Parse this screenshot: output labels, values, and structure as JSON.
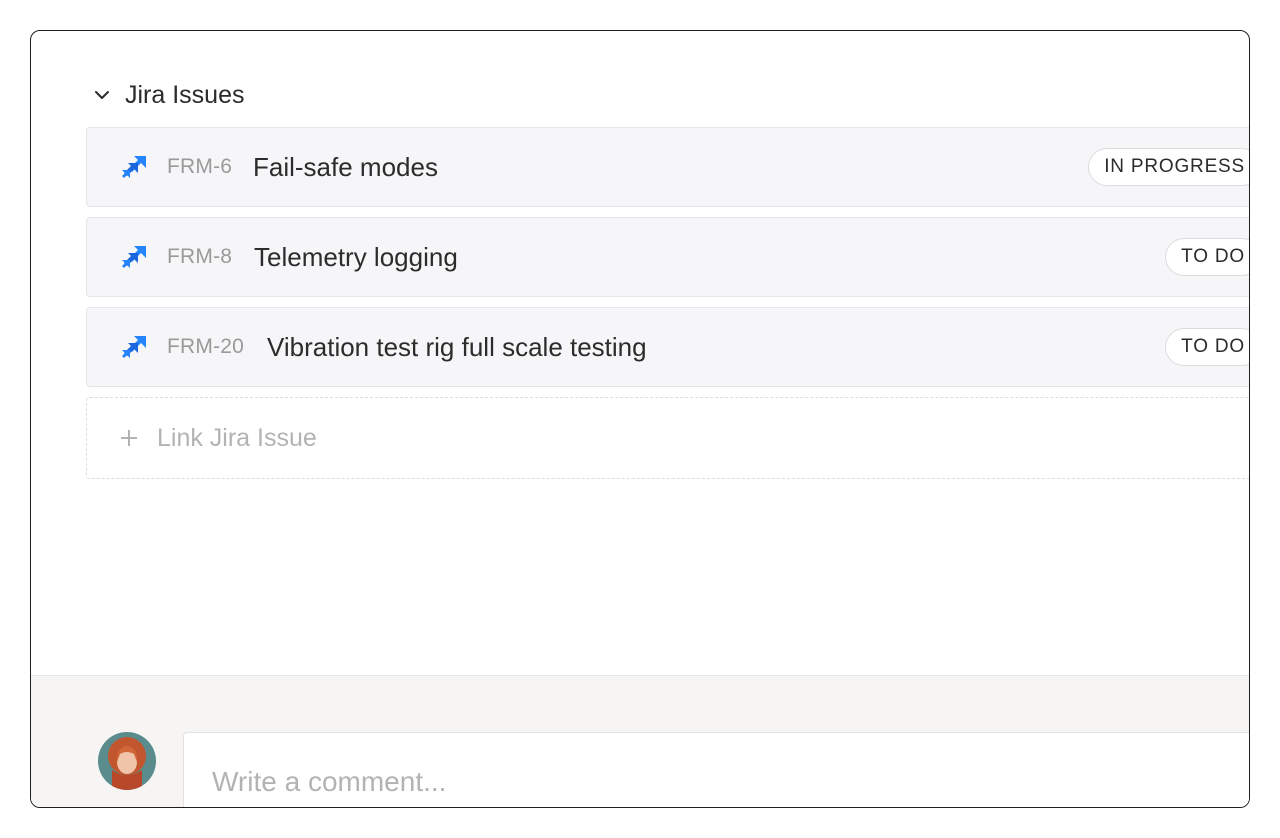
{
  "section": {
    "title": "Jira Issues",
    "collapse_icon": "chevron-down-icon"
  },
  "issues": [
    {
      "key": "FRM-6",
      "title": "Fail-safe modes",
      "status": "IN PROGRESS",
      "icon": "jira-icon"
    },
    {
      "key": "FRM-8",
      "title": "Telemetry logging",
      "status": "TO DO",
      "icon": "jira-icon"
    },
    {
      "key": "FRM-20",
      "title": "Vibration test rig full scale testing",
      "status": "TO DO",
      "icon": "jira-icon"
    }
  ],
  "link_issue": {
    "label": "Link Jira Issue",
    "icon": "plus-icon"
  },
  "comment": {
    "placeholder": "Write a comment..."
  },
  "colors": {
    "jira_blue": "#2684ff",
    "jira_blue_dark": "#1b66dd",
    "row_bg": "#f6f6f8",
    "footer_bg": "#f6f5f4"
  }
}
